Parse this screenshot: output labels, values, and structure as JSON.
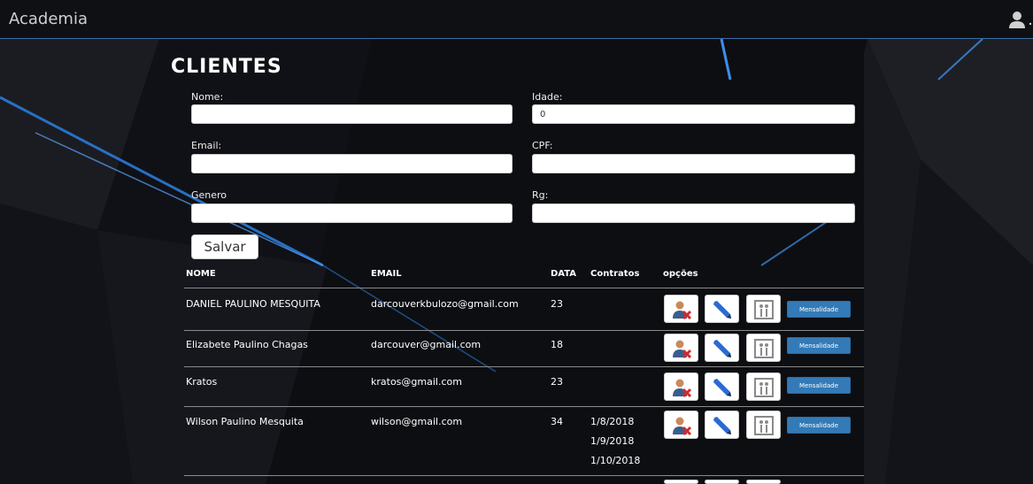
{
  "navbar": {
    "brand": "Academia",
    "user_icon": "user-icon"
  },
  "form": {
    "title": "CLIENTES",
    "nome_label": "Nome:",
    "nome_value": "",
    "idade_label": "Idade:",
    "idade_value": "0",
    "email_label": "Email:",
    "email_value": "",
    "cpf_label": "CPF:",
    "cpf_value": "",
    "genero_label": "Genero",
    "genero_value": "",
    "rg_label": "Rg:",
    "rg_value": "",
    "save_label": "Salvar"
  },
  "table": {
    "headers": {
      "nome": "NOME",
      "email": "EMAIL",
      "data": "DATA",
      "contratos": "Contratos",
      "opcoes": "opções"
    },
    "mensalidade_label": "Mensalidade",
    "rows": [
      {
        "nome": "DANIEL PAULINO MESQUITA",
        "email": "darcouverkbulozo@gmail.com",
        "data": "23",
        "contratos": []
      },
      {
        "nome": "Elizabete Paulino Chagas",
        "email": "darcouver@gmail.com",
        "data": "18",
        "contratos": []
      },
      {
        "nome": "Kratos",
        "email": "kratos@gmail.com",
        "data": "23",
        "contratos": []
      },
      {
        "nome": "Wilson Paulino Mesquita",
        "email": "wilson@gmail.com",
        "data": "34",
        "contratos": [
          "1/8/2018",
          "1/9/2018",
          "1/10/2018"
        ]
      }
    ]
  },
  "colors": {
    "accent": "#337ab7",
    "navbar_border": "#3a6ea8",
    "background": "#0d0e12"
  }
}
